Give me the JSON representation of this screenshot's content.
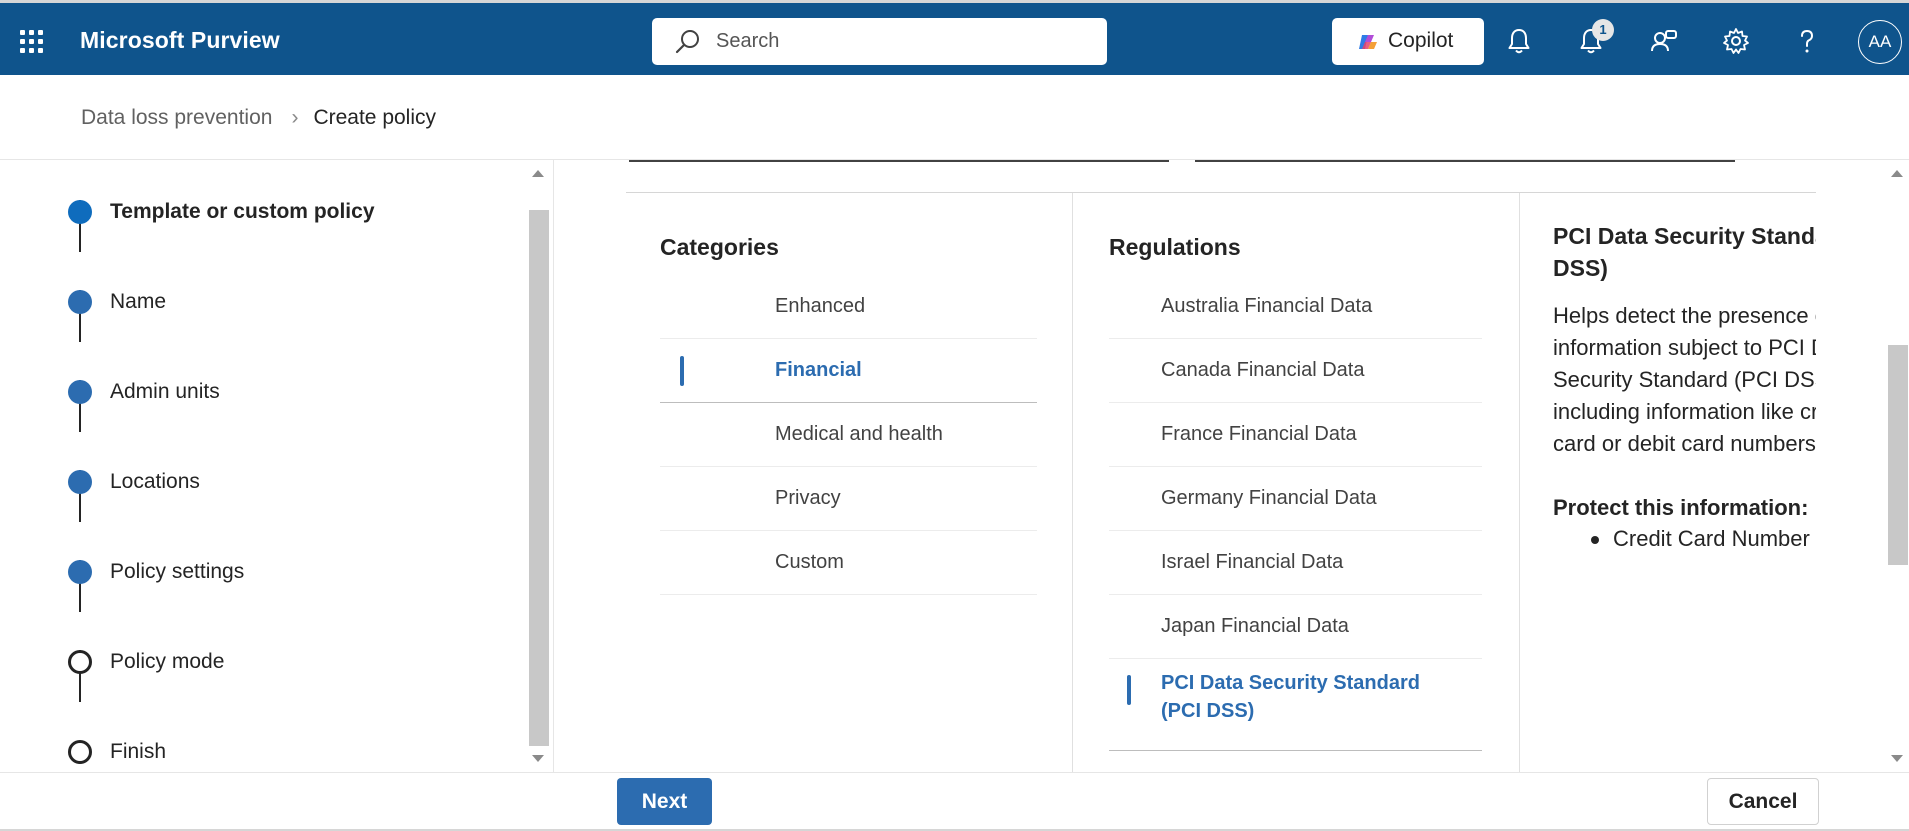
{
  "app": {
    "title": "Microsoft Purview"
  },
  "search": {
    "placeholder": "Search"
  },
  "copilot": {
    "label": "Copilot"
  },
  "notifications": {
    "badge_count": "1"
  },
  "user": {
    "initials": "AA"
  },
  "breadcrumb": {
    "parent": "Data loss prevention",
    "current": "Create policy"
  },
  "steps": [
    {
      "label": "Template or custom policy",
      "state": "current"
    },
    {
      "label": "Name",
      "state": "done"
    },
    {
      "label": "Admin units",
      "state": "done"
    },
    {
      "label": "Locations",
      "state": "done"
    },
    {
      "label": "Policy settings",
      "state": "done"
    },
    {
      "label": "Policy mode",
      "state": "todo"
    },
    {
      "label": "Finish",
      "state": "todo"
    }
  ],
  "categories": {
    "title": "Categories",
    "items": [
      "Enhanced",
      "Financial",
      "Medical and health",
      "Privacy",
      "Custom"
    ],
    "selected": "Financial"
  },
  "regulations": {
    "title": "Regulations",
    "items": [
      "Australia Financial Data",
      "Canada Financial Data",
      "France Financial Data",
      "Germany Financial Data",
      "Israel Financial Data",
      "Japan Financial Data",
      "PCI Data Security Standard (PCI DSS)"
    ],
    "selected_line1": "PCI Data Security Standard",
    "selected_line2": "(PCI DSS)"
  },
  "detail": {
    "title_line1": "PCI Data Security Standard (PCI",
    "title_line2": "DSS)",
    "desc_lines": [
      "Helps detect the presence of",
      "information subject to PCI Data",
      "Security Standard (PCI DSS),",
      "including information like credit",
      "card or debit card numbers."
    ],
    "protect_heading": "Protect this information:",
    "protect_items": [
      "Credit Card Number"
    ]
  },
  "footer": {
    "next_label": "Next",
    "cancel_label": "Cancel"
  },
  "colors": {
    "header_bg": "#0f548c",
    "accent": "#2c6cb0",
    "step_current": "#0f6cbd"
  }
}
